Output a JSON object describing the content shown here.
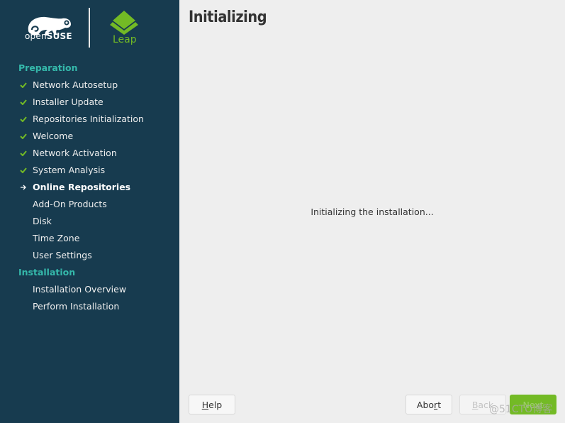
{
  "branding": {
    "opensuse_prefix": "open",
    "opensuse_suffix": "SUSE",
    "product": "Leap",
    "colors": {
      "sidebar_bg": "#173b4f",
      "section_heading": "#35b9ab",
      "check": "#73ba25",
      "leap_green": "#73ba25"
    }
  },
  "sidebar": {
    "sections": [
      {
        "heading": "Preparation",
        "items": [
          {
            "label": "Network Autosetup",
            "status": "done",
            "icon": "checkmark-icon"
          },
          {
            "label": "Installer Update",
            "status": "done",
            "icon": "checkmark-icon"
          },
          {
            "label": "Repositories Initialization",
            "status": "done",
            "icon": "checkmark-icon"
          },
          {
            "label": "Welcome",
            "status": "done",
            "icon": "checkmark-icon"
          },
          {
            "label": "Network Activation",
            "status": "done",
            "icon": "checkmark-icon"
          },
          {
            "label": "System Analysis",
            "status": "done",
            "icon": "checkmark-icon"
          },
          {
            "label": "Online Repositories",
            "status": "current",
            "icon": "arrow-right-icon"
          },
          {
            "label": "Add-On Products",
            "status": "pending"
          },
          {
            "label": "Disk",
            "status": "pending"
          },
          {
            "label": "Time Zone",
            "status": "pending"
          },
          {
            "label": "User Settings",
            "status": "pending"
          }
        ]
      },
      {
        "heading": "Installation",
        "items": [
          {
            "label": "Installation Overview",
            "status": "pending"
          },
          {
            "label": "Perform Installation",
            "status": "pending"
          }
        ]
      }
    ]
  },
  "main": {
    "title": "Initializing",
    "status": "Initializing the installation..."
  },
  "buttons": {
    "help": {
      "pre": "",
      "mnemonic": "H",
      "post": "elp",
      "enabled": true
    },
    "abort": {
      "pre": "Abo",
      "mnemonic": "r",
      "post": "t",
      "enabled": true
    },
    "back": {
      "pre": "",
      "mnemonic": "B",
      "post": "ack",
      "enabled": false
    },
    "next": {
      "pre": "Next",
      "mnemonic": "",
      "post": "",
      "enabled": false
    }
  },
  "watermark": "@51CTO博客"
}
